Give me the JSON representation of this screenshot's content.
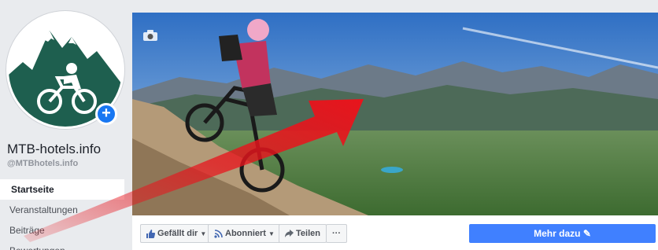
{
  "page": {
    "name": "MTB-hotels.info",
    "handle": "@MTBhotels.info"
  },
  "nav": {
    "items": [
      {
        "label": "Startseite",
        "active": true
      },
      {
        "label": "Veranstaltungen",
        "active": false
      },
      {
        "label": "Beiträge",
        "active": false
      },
      {
        "label": "Bewertungen",
        "active": false
      }
    ]
  },
  "actions": {
    "like_label": "Gefällt dir",
    "follow_label": "Abonniert",
    "share_label": "Teilen",
    "more_label": "···",
    "cta_label": "Mehr dazu"
  },
  "colors": {
    "brand_green": "#1e5f4f",
    "fb_blue": "#4080ff",
    "annotation_arrow": "#e8141c"
  }
}
